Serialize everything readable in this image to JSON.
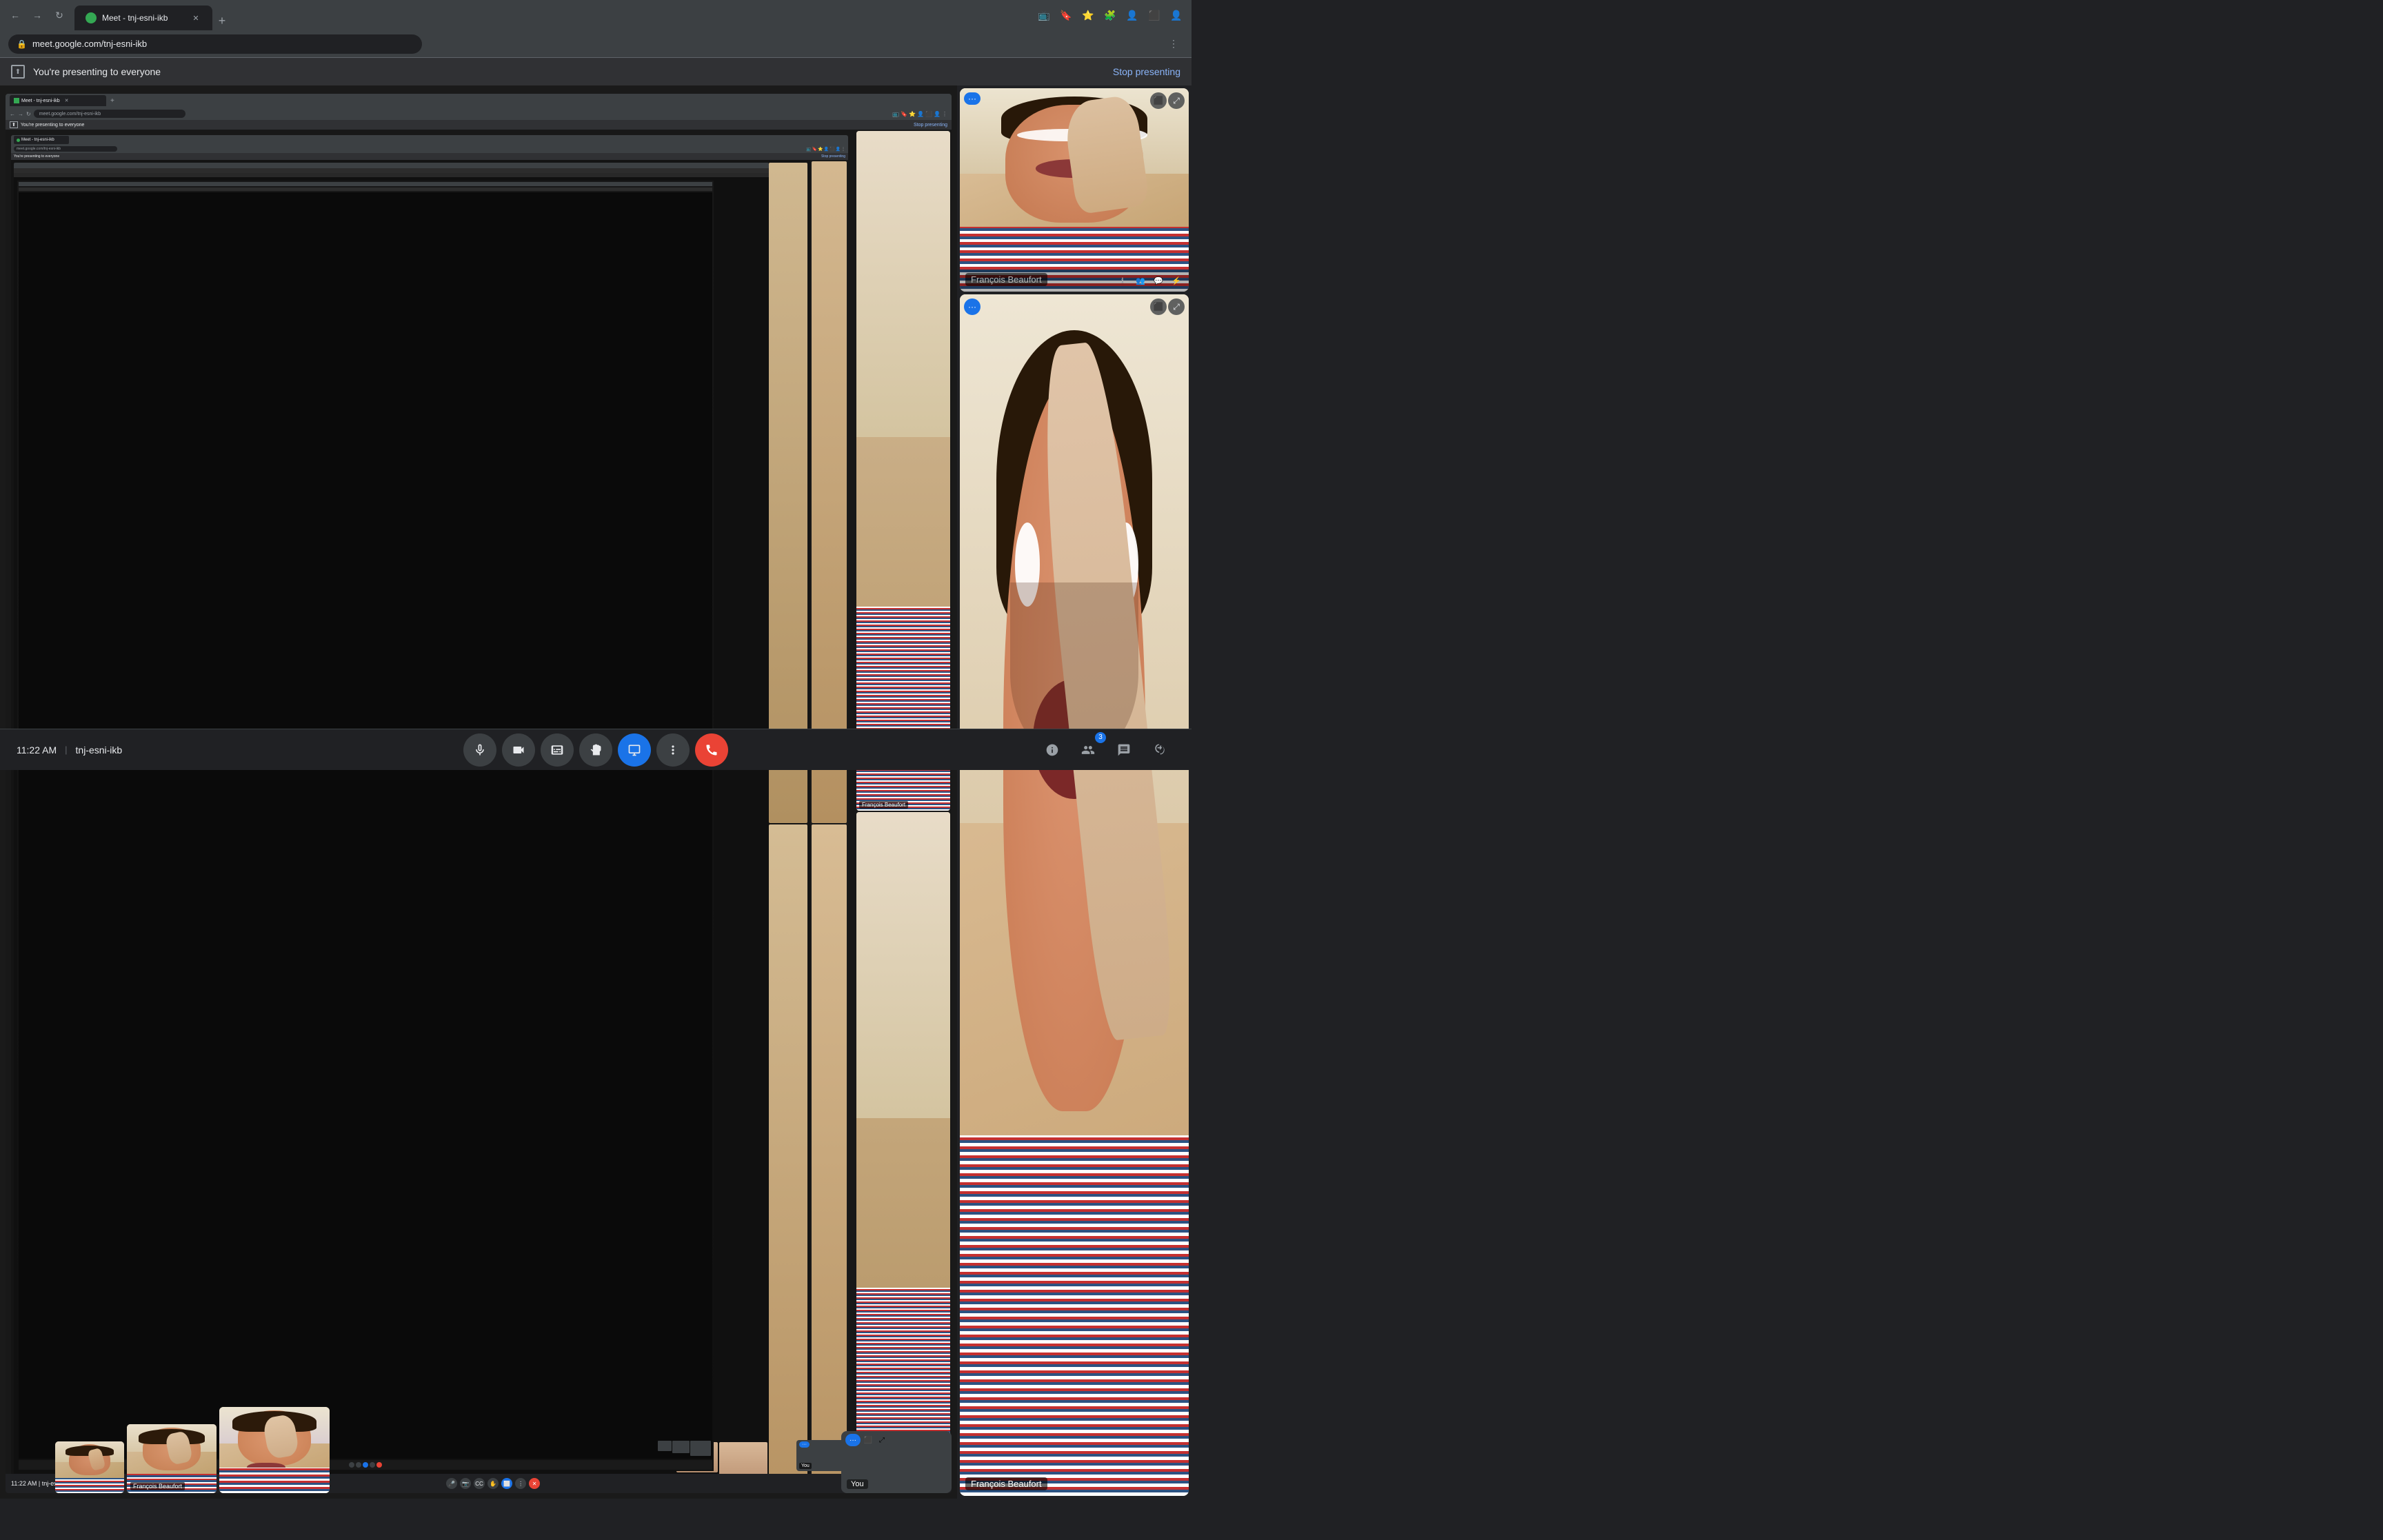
{
  "browser": {
    "tab_title": "Meet - tnj-esni-ikb",
    "tab_favicon_color": "#34a853",
    "url": "meet.google.com/tnj-esni-ikb",
    "new_tab_label": "+"
  },
  "banner": {
    "text": "You're presenting to everyone",
    "stop_button": "Stop presenting"
  },
  "participants": [
    {
      "name": "François Beaufort",
      "tile_size": "large"
    },
    {
      "name": "François Beaufort",
      "tile_size": "large"
    }
  ],
  "you_tile": {
    "label": "You"
  },
  "bottom_bar": {
    "time": "11:22 AM",
    "separator": "|",
    "room": "tnj-esni-ikb",
    "controls": [
      {
        "id": "mic",
        "label": "Microphone",
        "icon": "🎤",
        "active": false
      },
      {
        "id": "camera",
        "label": "Camera",
        "icon": "📷",
        "active": false
      },
      {
        "id": "captions",
        "label": "Captions",
        "icon": "CC",
        "active": false
      },
      {
        "id": "hand",
        "label": "Raise hand",
        "icon": "✋",
        "active": false
      },
      {
        "id": "present",
        "label": "Present now",
        "icon": "⬜",
        "active": true
      },
      {
        "id": "more",
        "label": "More options",
        "icon": "⋮",
        "active": false
      },
      {
        "id": "end",
        "label": "Leave call",
        "icon": "✕",
        "danger": true
      }
    ],
    "right_buttons": [
      {
        "id": "info",
        "label": "Meeting details",
        "icon": "ℹ"
      },
      {
        "id": "people",
        "label": "People",
        "icon": "👥",
        "badge": "3"
      },
      {
        "id": "chat",
        "label": "Chat",
        "icon": "💬"
      },
      {
        "id": "activities",
        "label": "Activities",
        "icon": "⚡"
      }
    ]
  },
  "colors": {
    "bg": "#202124",
    "panel_bg": "#3c4043",
    "active_blue": "#1a73e8",
    "danger_red": "#ea4335",
    "text_primary": "#e8eaed",
    "text_secondary": "#9aa0a6",
    "banner_bg": "#303134"
  }
}
